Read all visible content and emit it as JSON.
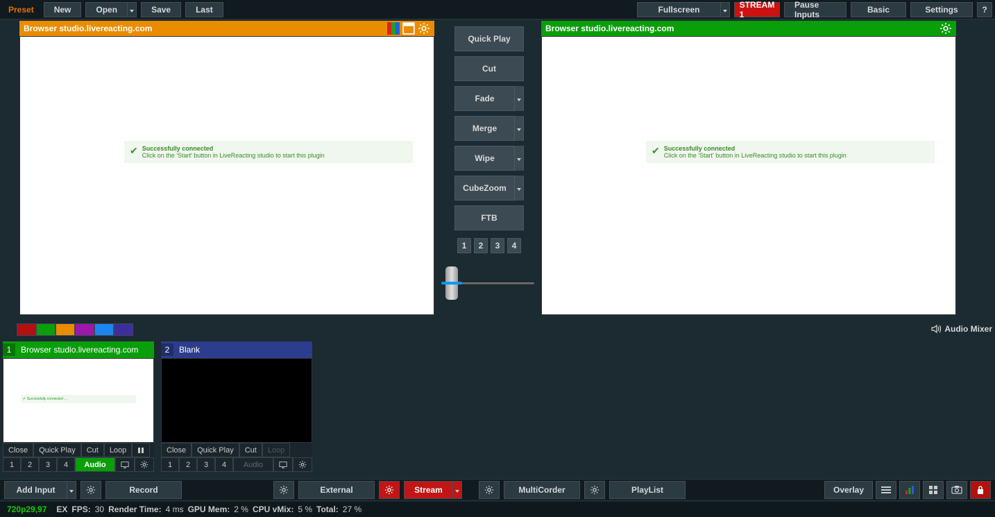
{
  "toolbar": {
    "preset_label": "Preset",
    "new_label": "New",
    "open_label": "Open",
    "save_label": "Save",
    "last_label": "Last",
    "fullscreen_label": "Fullscreen",
    "stream1_label": "STREAM 1",
    "pause_inputs_label": "Pause Inputs",
    "basic_label": "Basic",
    "settings_label": "Settings",
    "help_label": "?"
  },
  "previews": {
    "left": {
      "title": "Browser studio.livereacting.com",
      "msg_title": "Successfully connected",
      "msg_body": "Click on the 'Start' button in LiveReacting studio to start this plugin"
    },
    "right": {
      "title": "Browser studio.livereacting.com",
      "msg_title": "Successfully connected",
      "msg_body": "Click on the 'Start' button in LiveReacting studio to start this plugin"
    }
  },
  "transitions": {
    "quick_play": "Quick Play",
    "cut": "Cut",
    "fade": "Fade",
    "merge": "Merge",
    "wipe": "Wipe",
    "cubezoom": "CubeZoom",
    "ftb": "FTB",
    "numbers": [
      "1",
      "2",
      "3",
      "4"
    ]
  },
  "color_strip": [
    "#b31010",
    "#0a9e0a",
    "#ea8c00",
    "#9c18aa",
    "#1c86ee",
    "#3b2f9e"
  ],
  "audio_mixer_label": "Audio Mixer",
  "inputs": [
    {
      "index": "1",
      "title": "Browser studio.livereacting.com",
      "state": "active",
      "close": "Close",
      "quick_play": "Quick Play",
      "cut": "Cut",
      "loop": "Loop",
      "audio": "Audio",
      "nums": [
        "1",
        "2",
        "3",
        "4"
      ]
    },
    {
      "index": "2",
      "title": "Blank",
      "state": "preview",
      "close": "Close",
      "quick_play": "Quick Play",
      "cut": "Cut",
      "loop": "Loop",
      "audio": "Audio",
      "nums": [
        "1",
        "2",
        "3",
        "4"
      ]
    }
  ],
  "bottom": {
    "add_input": "Add Input",
    "record": "Record",
    "external": "External",
    "stream": "Stream",
    "multicorder": "MultiCorder",
    "playlist": "PlayList",
    "overlay": "Overlay"
  },
  "status": {
    "resolution": "720p29,97",
    "ex": "EX",
    "fps_label": "FPS:",
    "fps_value": "30",
    "render_label": "Render Time:",
    "render_value": "4 ms",
    "gpu_label": "GPU Mem:",
    "gpu_value": "2 %",
    "cpu_label": "CPU vMix:",
    "cpu_value": "5 %",
    "total_label": "Total:",
    "total_value": "27 %"
  }
}
